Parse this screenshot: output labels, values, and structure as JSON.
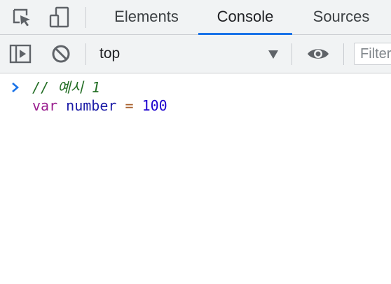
{
  "tabs": {
    "elements": "Elements",
    "console": "Console",
    "sources": "Sources",
    "active": "Console"
  },
  "toolbar": {
    "context": "top",
    "filter_placeholder": "Filter"
  },
  "console": {
    "line1": {
      "comment": "// 예시 1"
    },
    "line2": {
      "keyword": "var",
      "variable": "number",
      "operator": "=",
      "number": "100"
    }
  },
  "colors": {
    "accent": "#1a73e8",
    "toolbar_bg": "#f1f3f4",
    "comment": "#236e25",
    "keyword": "#9a1f8f",
    "variable": "#1a1aa6",
    "operator": "#a8602d",
    "number": "#1c00cf"
  },
  "icons": {
    "inspect": "inspect-element-icon",
    "device": "device-toolbar-icon",
    "sidebar": "show-sidebar-icon",
    "clear": "clear-console-icon",
    "context_dropdown": "dropdown-triangle-icon",
    "live_expression": "eye-icon",
    "prompt": "chevron-right-icon"
  }
}
